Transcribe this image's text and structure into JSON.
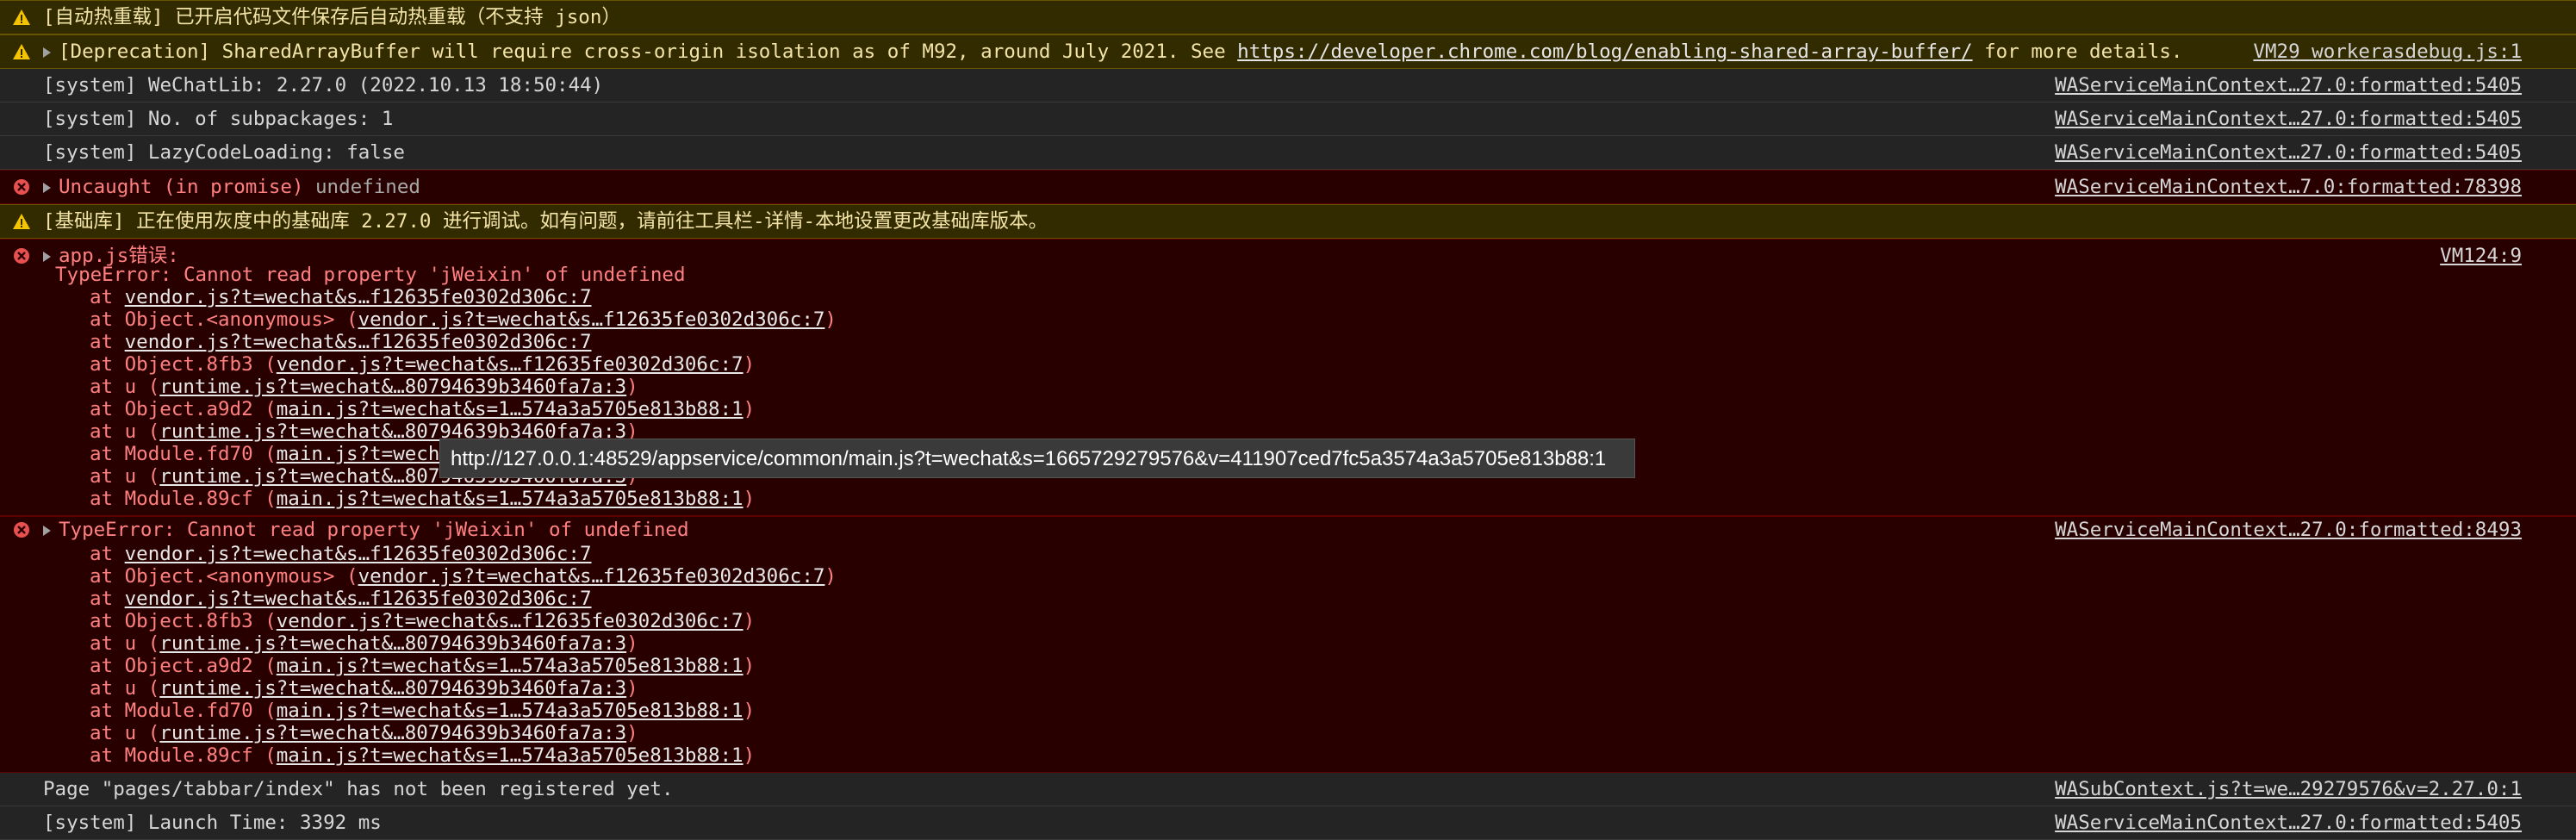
{
  "colors": {
    "warning_icon": "#f5c400",
    "error_icon": "#e85151",
    "error_text": "#ff8080",
    "background": "#242424"
  },
  "messages": [
    {
      "level": "warning",
      "text": "[自动热重载] 已开启代码文件保存后自动热重载（不支持 json）",
      "source": ""
    },
    {
      "level": "warning",
      "text_before": "[Deprecation] SharedArrayBuffer will require cross-origin isolation as of M92, around July 2021. See ",
      "link": "https://developer.chrome.com/blog/enabling-shared-array-buffer/",
      "text_after": " for more details.",
      "source": "VM29 workerasdebug.js:1"
    },
    {
      "level": "info",
      "text": "[system] WeChatLib: 2.27.0 (2022.10.13 18:50:44)",
      "source": "WAServiceMainContext…27.0:formatted:5405"
    },
    {
      "level": "info",
      "text": "[system] No. of subpackages: 1",
      "source": "WAServiceMainContext…27.0:formatted:5405"
    },
    {
      "level": "info",
      "text": "[system] LazyCodeLoading: false",
      "source": "WAServiceMainContext…27.0:formatted:5405"
    },
    {
      "level": "error",
      "text_a": "Uncaught (in promise) ",
      "text_b": "undefined",
      "source": "WAServiceMainContext…7.0:formatted:78398"
    },
    {
      "level": "warning",
      "text": "[基础库] 正在使用灰度中的基础库 2.27.0 进行调试。如有问题，请前往工具栏-详情-本地设置更改基础库版本。",
      "source": ""
    },
    {
      "level": "error",
      "text": "app.js错误:",
      "sub": "TypeError: Cannot read property 'jWeixin' of undefined",
      "source": "VM124:9",
      "stack": [
        {
          "pre": "at ",
          "fn": "",
          "file": "vendor.js?t=wechat&s…f12635fe0302d306c:7"
        },
        {
          "pre": "at Object.<anonymous> (",
          "fn": "",
          "file": "vendor.js?t=wechat&s…f12635fe0302d306c:7"
        },
        {
          "pre": "at ",
          "fn": "",
          "file": "vendor.js?t=wechat&s…f12635fe0302d306c:7"
        },
        {
          "pre": "at Object.8fb3 (",
          "fn": "",
          "file": "vendor.js?t=wechat&s…f12635fe0302d306c:7"
        },
        {
          "pre": "at u (",
          "fn": "",
          "file": "runtime.js?t=wechat&…80794639b3460fa7a:3"
        },
        {
          "pre": "at Object.a9d2 (",
          "fn": "",
          "file": "main.js?t=wechat&s=1…574a3a5705e813b88:1"
        },
        {
          "pre": "at u (",
          "fn": "",
          "file": "runtime.js?t=wechat&…80794639b3460fa7a:3"
        },
        {
          "pre": "at Module.fd70 (",
          "fn": "",
          "file": "main.js?t=wechat&s=1…574a3a5705e813b88:1"
        },
        {
          "pre": "at u (",
          "fn": "",
          "file": "runtime.js?t=wechat&…80794639b3460fa7a:3"
        },
        {
          "pre": "at Module.89cf (",
          "fn": "",
          "file": "main.js?t=wechat&s=1…574a3a5705e813b88:1"
        }
      ]
    },
    {
      "level": "error",
      "text": "TypeError: Cannot read property 'jWeixin' of undefined",
      "source": "WAServiceMainContext…27.0:formatted:8493",
      "stack": [
        {
          "pre": "at ",
          "file": "vendor.js?t=wechat&s…f12635fe0302d306c:7"
        },
        {
          "pre": "at Object.<anonymous> (",
          "file": "vendor.js?t=wechat&s…f12635fe0302d306c:7"
        },
        {
          "pre": "at ",
          "file": "vendor.js?t=wechat&s…f12635fe0302d306c:7"
        },
        {
          "pre": "at Object.8fb3 (",
          "file": "vendor.js?t=wechat&s…f12635fe0302d306c:7"
        },
        {
          "pre": "at u (",
          "file": "runtime.js?t=wechat&…80794639b3460fa7a:3"
        },
        {
          "pre": "at Object.a9d2 (",
          "file": "main.js?t=wechat&s=1…574a3a5705e813b88:1"
        },
        {
          "pre": "at u (",
          "file": "runtime.js?t=wechat&…80794639b3460fa7a:3"
        },
        {
          "pre": "at Module.fd70 (",
          "file": "main.js?t=wechat&s=1…574a3a5705e813b88:1"
        },
        {
          "pre": "at u (",
          "file": "runtime.js?t=wechat&…80794639b3460fa7a:3"
        },
        {
          "pre": "at Module.89cf (",
          "file": "main.js?t=wechat&s=1…574a3a5705e813b88:1"
        }
      ]
    },
    {
      "level": "info",
      "text": "Page \"pages/tabbar/index\" has not been registered yet.",
      "source": "WASubContext.js?t=we…29279576&v=2.27.0:1"
    },
    {
      "level": "info",
      "text": "[system] Launch Time: 3392 ms",
      "source": "WAServiceMainContext…27.0:formatted:5405"
    }
  ],
  "tooltip": "http://127.0.0.1:48529/appservice/common/main.js?t=wechat&s=1665729279576&v=411907ced7fc5a3574a3a5705e813b88:1"
}
